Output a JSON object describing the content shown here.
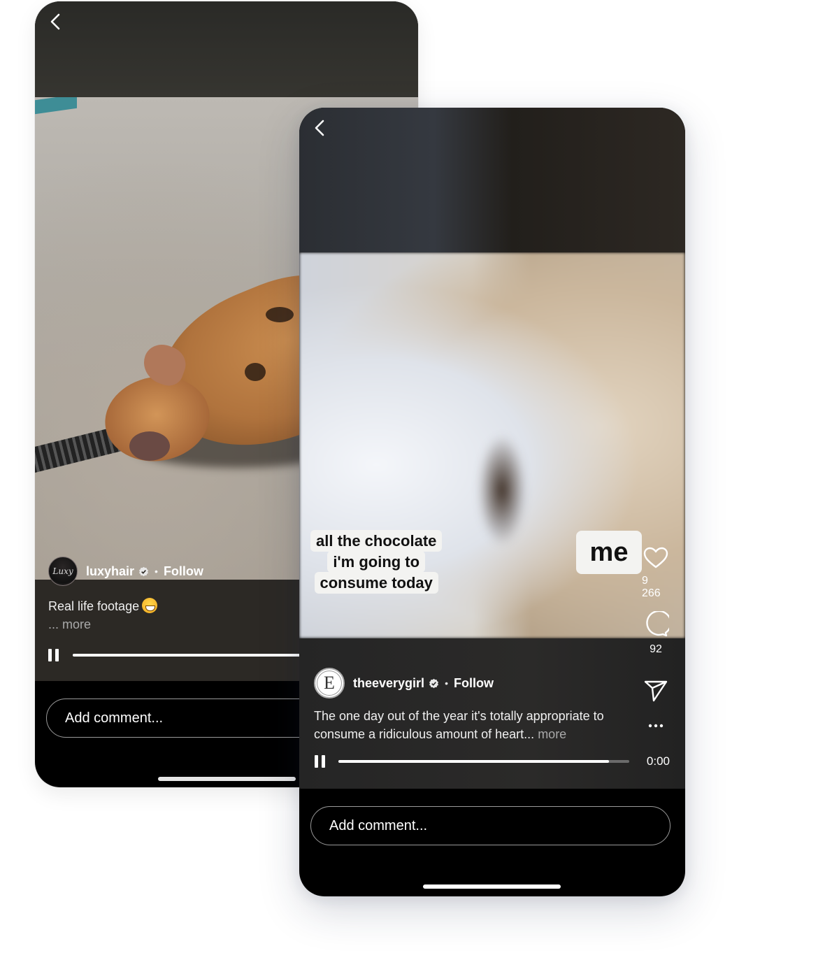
{
  "back_screen": {
    "nav": {
      "back_icon": "chevron-left-icon"
    },
    "author": {
      "username": "luxyhair",
      "avatar_text": "Luxy",
      "verified": true,
      "separator": "•",
      "follow_label": "Follow"
    },
    "post": {
      "caption": "Real life footage",
      "caption_emoji": "grinning-face-with-sweat",
      "more_label": "... more"
    },
    "player": {
      "state": "playing",
      "progress_fraction": 1.0
    },
    "comment": {
      "placeholder": "Add comment..."
    }
  },
  "front_screen": {
    "nav": {
      "back_icon": "chevron-left-icon"
    },
    "video_overlay": {
      "caption_lines": [
        "all the chocolate",
        "i'm going to",
        "consume today"
      ],
      "sticker": "me"
    },
    "actions": {
      "like": {
        "icon": "heart-icon",
        "count": "9 266"
      },
      "comment": {
        "icon": "comment-bubble-icon",
        "count": "92"
      },
      "share": {
        "icon": "send-icon"
      },
      "more": {
        "icon": "more-dots-icon"
      }
    },
    "author": {
      "username": "theeverygirl",
      "avatar_text": "E",
      "verified": true,
      "separator": "•",
      "follow_label": "Follow"
    },
    "post": {
      "caption": "The one day out of the year it's totally appropriate to consume a ridiculous amount of heart...",
      "more_label": "more"
    },
    "player": {
      "state": "playing",
      "progress_fraction": 0.93,
      "time": "0:00"
    },
    "comment": {
      "placeholder": "Add comment..."
    }
  }
}
